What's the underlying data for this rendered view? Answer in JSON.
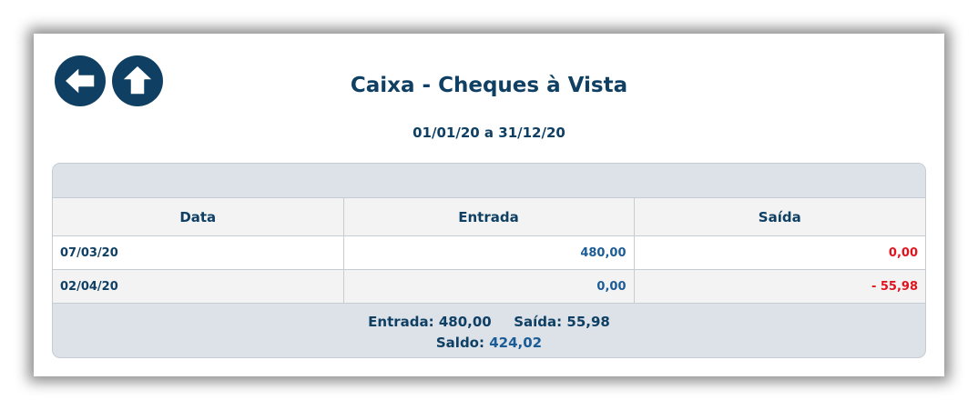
{
  "header": {
    "title": "Caixa - Cheques à Vista",
    "period": "01/01/20 a 31/12/20"
  },
  "nav": {
    "back_icon": "arrow-left-icon",
    "home_icon": "arrow-up-icon",
    "button_color": "#0f4064"
  },
  "table": {
    "columns": [
      "Data",
      "Entrada",
      "Saída"
    ],
    "rows": [
      {
        "date": "07/03/20",
        "entrada": "480,00",
        "saida": "0,00"
      },
      {
        "date": "02/04/20",
        "entrada": "0,00",
        "saida": "- 55,98"
      }
    ]
  },
  "summary": {
    "entrada_label": "Entrada:",
    "entrada_value": "480,00",
    "saida_label": "Saída:",
    "saida_value": "55,98",
    "saldo_label": "Saldo:",
    "saldo_value": "424,02"
  },
  "colors": {
    "primary": "#0f4064",
    "positive": "#1c5c96",
    "negative": "#e0141e"
  }
}
